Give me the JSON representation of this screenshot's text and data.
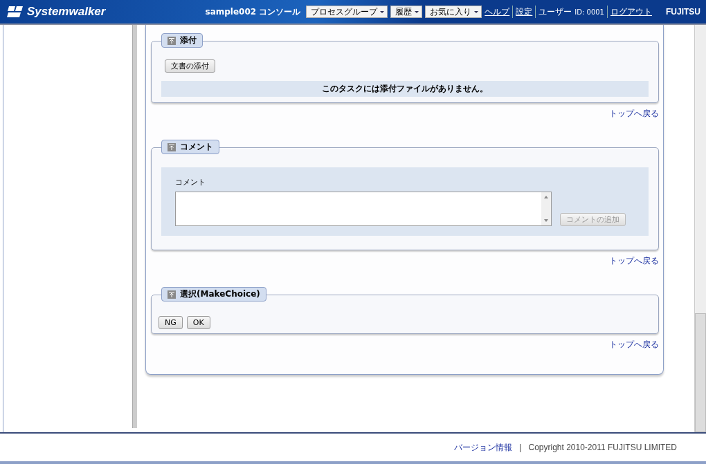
{
  "header": {
    "logo": "Systemwalker",
    "title": "sample002 コンソール",
    "menus": [
      {
        "label": "プロセスグループ"
      },
      {
        "label": "履歴"
      },
      {
        "label": "お気に入り"
      }
    ],
    "links": [
      "ヘルプ",
      "設定"
    ],
    "user_label": "ユーザー",
    "user_id": "ID: 0001",
    "logout": "ログアウト",
    "brand": "FUJITSU"
  },
  "sections": [
    {
      "kind": "attachments",
      "title": "添付",
      "button": "文書の添付",
      "message": "このタスクには添付ファイルがありません。",
      "back_link": "トップへ戻る"
    },
    {
      "kind": "comment",
      "title": "コメント",
      "field_label": "コメント",
      "button": {
        "label": "コメントの追加",
        "disabled": true
      },
      "back_link": "トップへ戻る"
    },
    {
      "kind": "choice",
      "title": "選択(MakeChoice)",
      "buttons": [
        "NG",
        "OK"
      ],
      "back_link": "トップへ戻る"
    }
  ],
  "footer": {
    "link": "バージョン情報",
    "separator": "|",
    "copyright": "Copyright 2010-2011 FUJITSU LIMITED"
  }
}
